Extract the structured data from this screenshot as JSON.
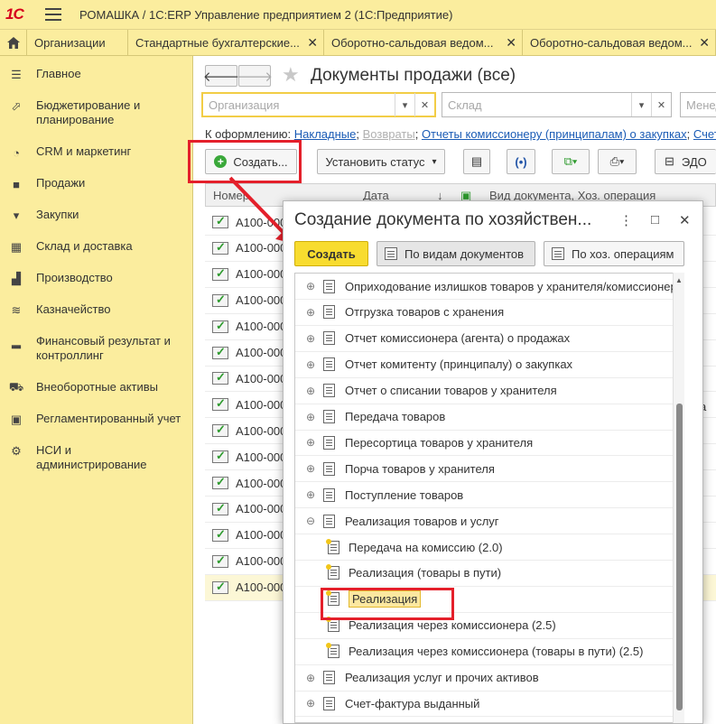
{
  "app": {
    "title": "РОМАШКА / 1С:ERP Управление предприятием 2  (1С:Предприятие)",
    "logo": "1С"
  },
  "tabs": [
    {
      "label": "Организации"
    },
    {
      "label": "Стандартные бухгалтерские..."
    },
    {
      "label": "Оборотно-сальдовая ведом..."
    },
    {
      "label": "Оборотно-сальдовая ведом..."
    }
  ],
  "sidebar": {
    "items": [
      {
        "label": "Главное",
        "icon": "list-icon"
      },
      {
        "label": "Бюджетирование и планирование",
        "icon": "chart-icon"
      },
      {
        "label": "CRM и маркетинг",
        "icon": "pie-icon"
      },
      {
        "label": "Продажи",
        "icon": "bag-icon"
      },
      {
        "label": "Закупки",
        "icon": "cart-icon"
      },
      {
        "label": "Склад и доставка",
        "icon": "grid-icon"
      },
      {
        "label": "Производство",
        "icon": "factory-icon"
      },
      {
        "label": "Казначейство",
        "icon": "coins-icon"
      },
      {
        "label": "Финансовый результат и контроллинг",
        "icon": "bars-icon"
      },
      {
        "label": "Внеоборотные активы",
        "icon": "truck-icon"
      },
      {
        "label": "Регламентированный учет",
        "icon": "calculator-icon"
      },
      {
        "label": "НСИ и администрирование",
        "icon": "gear-icon"
      }
    ]
  },
  "main": {
    "title": "Документы продажи (все)",
    "filters": {
      "org_placeholder": "Организация",
      "warehouse_placeholder": "Склад",
      "manager_placeholder": "Менед"
    },
    "links": {
      "label": "К оформлению:",
      "items": [
        "Накладные",
        "Возвраты",
        "Отчеты комиссионеру (принципалам) о закупках",
        "Счета-ф"
      ]
    },
    "toolbar": {
      "create": "Создать...",
      "set_status": "Установить статус",
      "edo": "ЭДО"
    },
    "columns": [
      "Номер",
      "Дата",
      "Вид документа, Хоз. операция"
    ],
    "rows": [
      "А100-000",
      "А100-000",
      "А100-000",
      "А100-000",
      "А100-000",
      "А100-000",
      "А100-000",
      "А100-000",
      "А100-000",
      "А100-000",
      "А100-000",
      "А100-000",
      "А100-000",
      "А100-000",
      "А100-000"
    ],
    "right_fragment": "a"
  },
  "dialog": {
    "title": "Создание документа по хозяйствен...",
    "buttons": {
      "create": "Создать",
      "by_doc_types": "По видам документов",
      "by_operations": "По хоз. операциям"
    },
    "tree": [
      {
        "label": "Оприходование излишков товаров у хранителя/комиссионер",
        "level": 0,
        "expander": "⊕"
      },
      {
        "label": "Отгрузка товаров с хранения",
        "level": 0,
        "expander": "⊕"
      },
      {
        "label": "Отчет комиссионера (агента) о продажах",
        "level": 0,
        "expander": "⊕"
      },
      {
        "label": "Отчет комитенту (принципалу) о закупках",
        "level": 0,
        "expander": "⊕"
      },
      {
        "label": "Отчет о списании товаров у хранителя",
        "level": 0,
        "expander": "⊕"
      },
      {
        "label": "Передача товаров",
        "level": 0,
        "expander": "⊕"
      },
      {
        "label": "Пересортица товаров у хранителя",
        "level": 0,
        "expander": "⊕"
      },
      {
        "label": "Порча товаров у хранителя",
        "level": 0,
        "expander": "⊕"
      },
      {
        "label": "Поступление товаров",
        "level": 0,
        "expander": "⊕"
      },
      {
        "label": "Реализация товаров и услуг",
        "level": 0,
        "expander": "⊖"
      },
      {
        "label": "Передача на комиссию (2.0)",
        "level": 1,
        "expander": ""
      },
      {
        "label": "Реализация (товары в пути)",
        "level": 1,
        "expander": ""
      },
      {
        "label": "Реализация",
        "level": 1,
        "expander": "",
        "selected": true
      },
      {
        "label": "Реализация через комиссионера (2.5)",
        "level": 1,
        "expander": ""
      },
      {
        "label": "Реализация через комиссионера (товары в пути) (2.5)",
        "level": 1,
        "expander": ""
      },
      {
        "label": "Реализация услуг и прочих активов",
        "level": 0,
        "expander": "⊕"
      },
      {
        "label": "Счет-фактура выданный",
        "level": 0,
        "expander": "⊕"
      }
    ]
  },
  "colors": {
    "accent": "#fbed9e",
    "primary_button": "#f8dc2f",
    "highlight": "#e4202b",
    "link": "#1a5bb5"
  }
}
